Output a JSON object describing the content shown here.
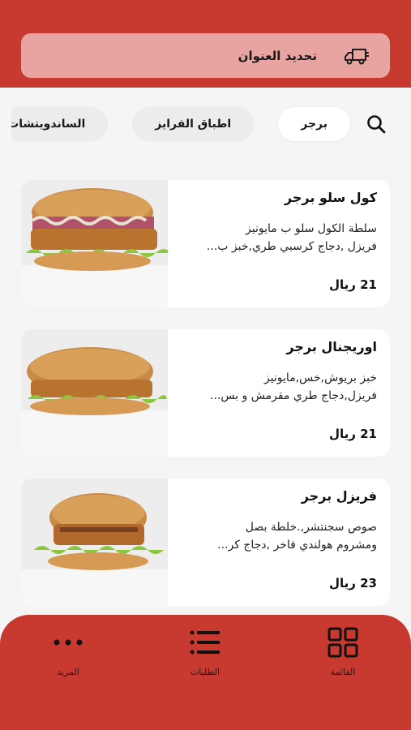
{
  "header": {
    "address_label": "تحديد العنوان",
    "icon": "delivery-truck-icon",
    "bg_color": "#c83a30",
    "bar_color": "#e8a4a0"
  },
  "categories": {
    "items": [
      {
        "label": "برجر",
        "active": true
      },
      {
        "label": "اطباق الفرايز",
        "active": false
      },
      {
        "label": "الساندويتشات",
        "active": false
      }
    ]
  },
  "products": [
    {
      "title": "كول سلو برجر",
      "desc_line1": "سلطة الكول سلو ب مايونيز",
      "desc_line2": "فريزل ,دجاج كرسبي طري,خبز ب...",
      "price": "21 ريال"
    },
    {
      "title": "اوريجنال برجر",
      "desc_line1": "خبز بريوش,خس,مايونيز",
      "desc_line2": "فريزل,دجاج طري مقرمش و بس...",
      "price": "21 ريال"
    },
    {
      "title": "فريزل برجر",
      "desc_line1": "صوص سجنتشر,.خلطة بصل",
      "desc_line2": "ومشروم هولندي فاخر ,دجاج كر...",
      "price": "23 ريال"
    }
  ],
  "bottom_nav": {
    "menu": "القائمة",
    "orders": "الطلبات",
    "more": "المزيد"
  }
}
